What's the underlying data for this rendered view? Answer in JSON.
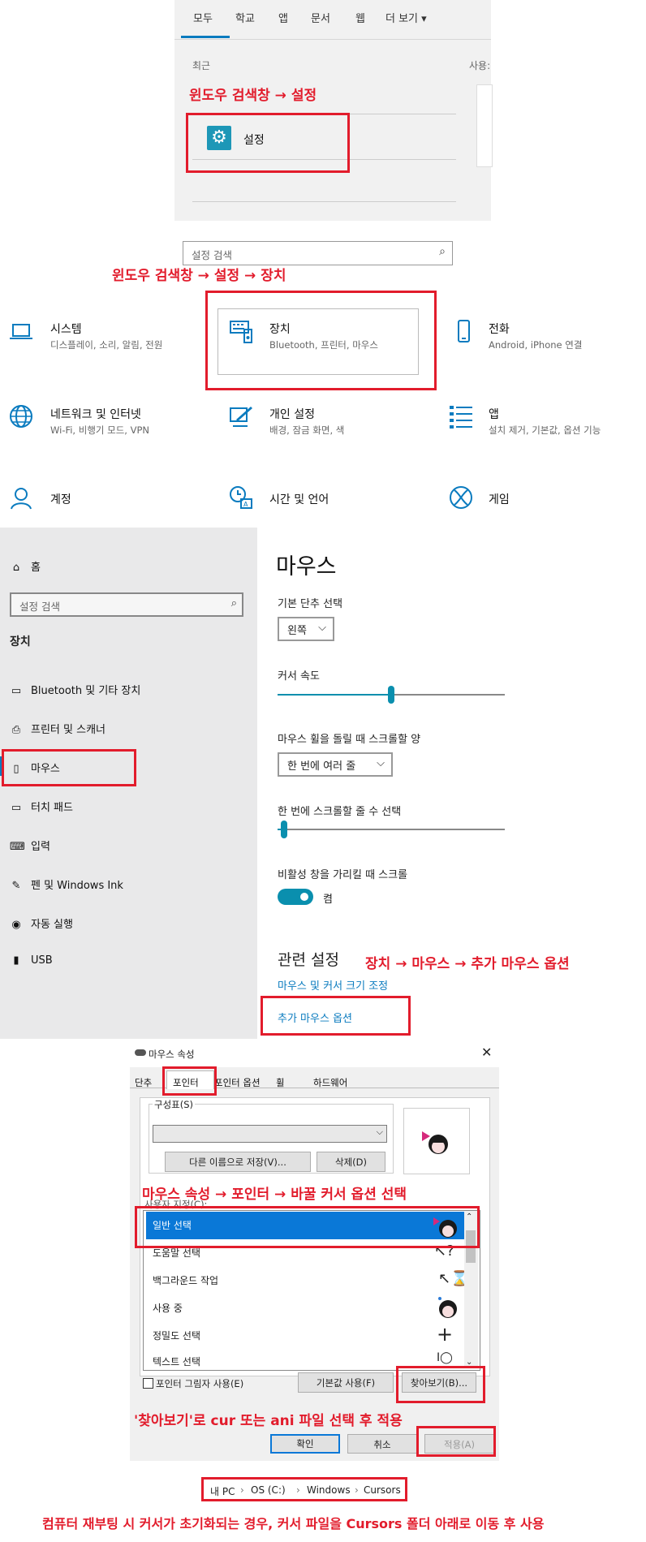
{
  "search_panel": {
    "tabs": [
      "모두",
      "학교",
      "앱",
      "문서",
      "웹",
      "더 보기 ▾"
    ],
    "recent_label": "최근",
    "usage_label": "사용:",
    "result_label": "설정",
    "annotation": "윈도우 검색창 → 설정"
  },
  "settings_home": {
    "search_placeholder": "설정 검색",
    "annotation": "윈도우 검색창 → 설정 → 장치",
    "items": [
      {
        "title": "시스템",
        "sub": "디스플레이, 소리, 알림, 전원",
        "icon": "laptop-icon"
      },
      {
        "title": "장치",
        "sub": "Bluetooth, 프린터, 마우스",
        "icon": "keyboard-icon"
      },
      {
        "title": "전화",
        "sub": "Android, iPhone 연결",
        "icon": "phone-icon"
      },
      {
        "title": "네트워크 및 인터넷",
        "sub": "Wi-Fi, 비행기 모드, VPN",
        "icon": "globe-icon"
      },
      {
        "title": "개인 설정",
        "sub": "배경, 잠금 화면, 색",
        "icon": "paint-icon"
      },
      {
        "title": "앱",
        "sub": "설치 제거, 기본값, 옵션 기능",
        "icon": "apps-list-icon"
      },
      {
        "title": "계정",
        "sub": "",
        "icon": "person-icon"
      },
      {
        "title": "시간 및 언어",
        "sub": "",
        "icon": "time-language-icon"
      },
      {
        "title": "게임",
        "sub": "",
        "icon": "xbox-icon"
      }
    ]
  },
  "mouse_settings": {
    "sidebar": {
      "home": "홈",
      "search_placeholder": "설정 검색",
      "section": "장치",
      "items": [
        "Bluetooth 및 기타 장치",
        "프린터 및 스캐너",
        "마우스",
        "터치 패드",
        "입력",
        "펜 및 Windows Ink",
        "자동 실행",
        "USB"
      ]
    },
    "title": "마우스",
    "primary_button_label": "기본 단추 선택",
    "primary_button_value": "왼쪽",
    "cursor_speed_label": "커서 속도",
    "cursor_speed_fraction": 0.5,
    "scroll_amount_label": "마우스 휠을 돌릴 때 스크롤할 양",
    "scroll_amount_value": "한 번에 여러 줄",
    "lines_label": "한 번에 스크롤할 줄 수 선택",
    "lines_fraction": 0.03,
    "inactive_label": "비활성 창을 가리킬 때 스크롤",
    "inactive_value": "켬",
    "related_title": "관련 설정",
    "link_resize": "마우스 및 커서 크기 조정",
    "link_additional": "추가 마우스 옵션",
    "annotation": "장치 → 마우스 → 추가 마우스 옵션"
  },
  "mouse_properties": {
    "title": "마우스 속성",
    "tabs": [
      "단추",
      "포인터",
      "포인터 옵션",
      "휠",
      "하드웨어"
    ],
    "scheme_label": "구성표(S)",
    "save_as": "다른 이름으로 저장(V)...",
    "delete": "삭제(D)",
    "customize_label": "사용자 지정(C):",
    "rows": [
      "일반 선택",
      "도움말 선택",
      "백그라운드 작업",
      "사용 중",
      "정밀도 선택",
      "텍스트 선택"
    ],
    "shadow_label": "포인터 그림자 사용(E)",
    "default_btn": "기본값 사용(F)",
    "browse_btn": "찾아보기(B)...",
    "ok": "확인",
    "cancel": "취소",
    "apply": "적용(A)",
    "annotation_pointer": "마우스 속성 → 포인터 → 바꿀 커서 옵션 선택",
    "annotation_browse": "'찾아보기'로 cur 또는 ani 파일 선택 후 적용"
  },
  "path_bar": {
    "segments": [
      "내 PC",
      "OS (C:)",
      "Windows",
      "Cursors"
    ]
  },
  "footer_note": "컴퓨터 재부팅 시 커서가 초기화되는 경우, 커서 파일을 Cursors 폴더 아래로 이동 후 사용"
}
